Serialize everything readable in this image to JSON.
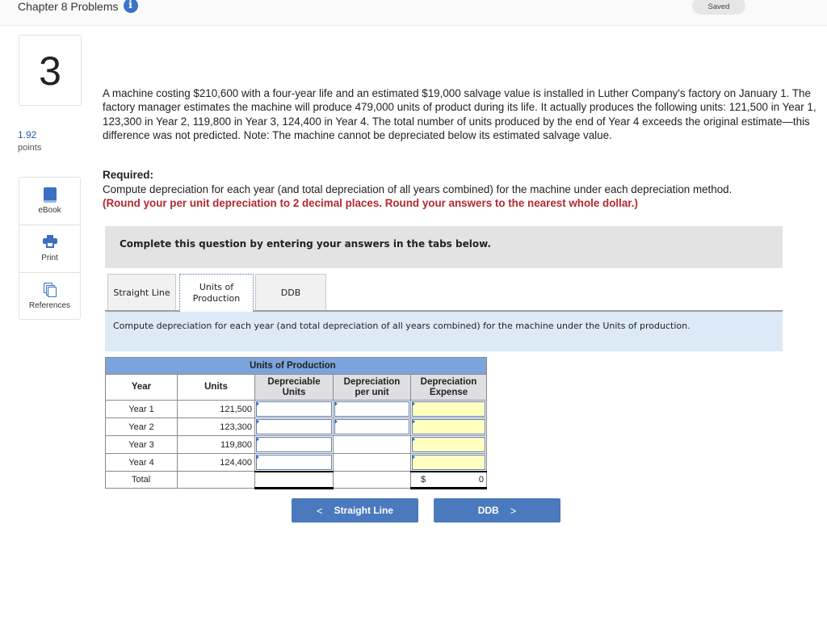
{
  "header": {
    "chapter_title": "Chapter 8 Problems",
    "info_icon": "info-icon",
    "status": "Saved"
  },
  "sidebar": {
    "question_number": "3",
    "points_value": "1.92",
    "points_label": "points",
    "tools": [
      {
        "label": "eBook",
        "icon": "book-icon"
      },
      {
        "label": "Print",
        "icon": "printer-icon"
      },
      {
        "label": "References",
        "icon": "documents-icon"
      }
    ]
  },
  "question": {
    "problem_text": "A machine costing $210,600 with a four-year life and an estimated $19,000 salvage value is installed in Luther Company's factory on January 1. The factory manager estimates the machine will produce 479,000 units of product during its life. It actually produces the following units: 121,500 in Year 1, 123,300 in Year 2, 119,800 in Year 3, 124,400 in Year 4. The total number of units produced by the end of Year 4 exceeds the original estimate—this difference was not predicted. Note: The machine cannot be depreciated below its estimated salvage value.",
    "required_heading": "Required:",
    "required_text": "Compute depreciation for each year (and total depreciation of all years combined) for the machine under each depreciation method.",
    "required_note": "(Round your per unit depreciation to 2 decimal places. Round your answers to the nearest whole dollar.)"
  },
  "instructions": "Complete this question by entering your answers in the tabs below.",
  "tabs": [
    {
      "label": "Straight Line",
      "active": false
    },
    {
      "label": "Units of Production",
      "active": true
    },
    {
      "label": "DDB",
      "active": false
    }
  ],
  "tab_prompt": "Compute depreciation for each year (and total depreciation of all years combined) for the machine under the Units of production.",
  "table": {
    "band_title": "Units of Production",
    "headers": {
      "year": "Year",
      "units": "Units",
      "depreciable_units": "Depreciable Units",
      "depreciation_per_unit": "Depreciation per unit",
      "depreciation_expense": "Depreciation Expense"
    },
    "rows": [
      {
        "year": "Year 1",
        "units": "121,500",
        "depreciable_units": "",
        "per_unit": "",
        "expense": ""
      },
      {
        "year": "Year 2",
        "units": "123,300",
        "depreciable_units": "",
        "per_unit": "",
        "expense": ""
      },
      {
        "year": "Year 3",
        "units": "119,800",
        "depreciable_units": "",
        "per_unit": "",
        "expense": ""
      },
      {
        "year": "Year 4",
        "units": "124,400",
        "depreciable_units": "",
        "per_unit": "",
        "expense": ""
      }
    ],
    "total": {
      "label": "Total",
      "currency": "$",
      "expense": "0"
    }
  },
  "navigation": {
    "prev_label": "Straight Line",
    "next_label": "DDB",
    "prev_chevron": "<",
    "next_chevron": ">"
  },
  "colors": {
    "accent_blue": "#4a79bd",
    "table_band": "#7ba4dd",
    "note_red": "#b3282d",
    "input_yellow": "#ffffc0"
  }
}
